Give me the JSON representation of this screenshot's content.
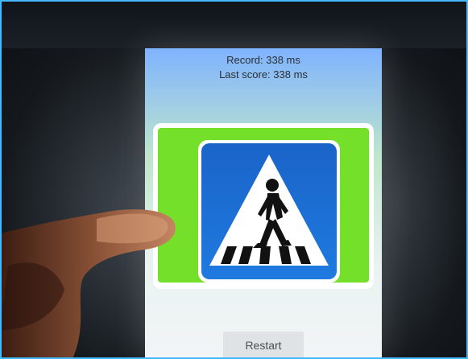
{
  "game": {
    "record_text": "Record: 338 ms",
    "last_score_text": "Last score: 338 ms",
    "sign_icon": "pedestrian-crossing-sign-icon",
    "restart_label": "Restart"
  },
  "colors": {
    "sign_blue": "#1f6fd6",
    "green_field": "#74e02a",
    "screen_top": "#7fb3ff"
  }
}
